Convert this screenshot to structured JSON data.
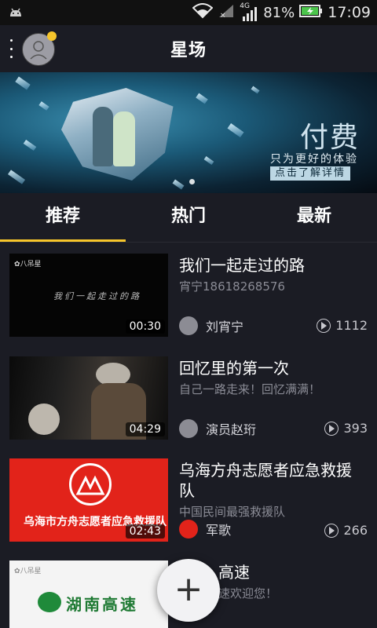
{
  "status_bar": {
    "network": "4G",
    "battery": "81%",
    "time": "17:09",
    "icons": [
      "android-icon",
      "wifi-icon",
      "no-sim-icon",
      "signal-icon",
      "battery-icon"
    ]
  },
  "header": {
    "title": "星场",
    "icons": [
      "menu-dots-icon",
      "avatar-icon"
    ],
    "notify_dot_color": "#f6c52b"
  },
  "banner": {
    "headline": "付费",
    "line1": "只为更好的体验",
    "line2": "点击了解详情"
  },
  "tabs": [
    {
      "label": "推荐",
      "active": true
    },
    {
      "label": "热门",
      "active": false
    },
    {
      "label": "最新",
      "active": false
    }
  ],
  "videos": [
    {
      "title": "我们一起走过的路",
      "subtitle": "宵宁18618268576",
      "author": "刘宵宁",
      "views": "1112",
      "duration": "00:30",
      "thumb_watermark": "八吊星",
      "thumb_caption": "我们一起走过的路"
    },
    {
      "title": "回忆里的第一次",
      "subtitle": "自己一路走来！回忆满满！",
      "author": "演员赵珩",
      "views": "393",
      "duration": "04:29"
    },
    {
      "title_line1": "乌海方舟志愿者应急救援",
      "title_line2": "队",
      "subtitle": "中国民间最强救援队",
      "author": "军歌",
      "views": "266",
      "duration": "02:43",
      "thumb_caption": "乌海市方舟志愿者应急救援队"
    },
    {
      "title": "高速",
      "subtitle": "速欢迎您！",
      "thumb_caption": "湖南高速",
      "thumb_watermark": "八吊星"
    }
  ],
  "fab": {
    "label": "+"
  },
  "colors": {
    "accent": "#f6c52b",
    "background": "#1b1c24"
  }
}
